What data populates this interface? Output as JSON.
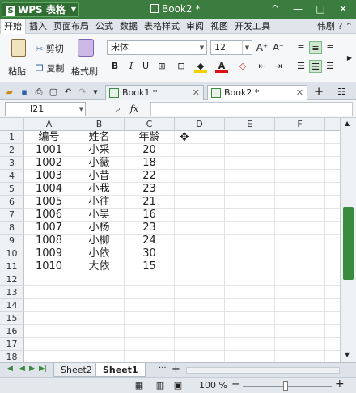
{
  "titlebar": {
    "app_name": "WPS 表格",
    "logo_letter": "S",
    "doc_title": "Book2 *",
    "controls": [
      "^",
      "—",
      "□",
      "✕"
    ]
  },
  "menubar": {
    "items": [
      "开始",
      "插入",
      "页面布局",
      "公式",
      "数据",
      "表格样式",
      "审阅",
      "视图",
      "开发工具"
    ],
    "active_index": 0,
    "right_text": "伟剧"
  },
  "ribbon": {
    "paste": "粘贴",
    "cut": "剪切",
    "copy": "复制",
    "format_painter": "格式刷",
    "font_name": "宋体",
    "font_size": "12",
    "bold": "B",
    "italic": "I",
    "underline": "U",
    "grow_font": "A⁺",
    "shrink_font": "A⁻"
  },
  "tabs": {
    "book1": "Book1 *",
    "book2": "Book2 *",
    "add": "+"
  },
  "formula": {
    "cell_ref": "I21",
    "zoom_icon": "🔍",
    "fx": "fx",
    "content": ""
  },
  "grid": {
    "columns": [
      "A",
      "B",
      "C",
      "D",
      "E",
      "F"
    ],
    "rows": [
      "1",
      "2",
      "3",
      "4",
      "5",
      "6",
      "7",
      "8",
      "9",
      "10",
      "11",
      "12",
      "13",
      "14",
      "15",
      "16",
      "17",
      "18"
    ],
    "data": [
      [
        "编号",
        "姓名",
        "年龄"
      ],
      [
        "1001",
        "小采",
        "20"
      ],
      [
        "1002",
        "小薇",
        "18"
      ],
      [
        "1003",
        "小昔",
        "22"
      ],
      [
        "1004",
        "小我",
        "23"
      ],
      [
        "1005",
        "小往",
        "21"
      ],
      [
        "1006",
        "小吴",
        "16"
      ],
      [
        "1007",
        "小杨",
        "23"
      ],
      [
        "1008",
        "小柳",
        "24"
      ],
      [
        "1009",
        "小依",
        "30"
      ],
      [
        "1010",
        "大依",
        "15"
      ]
    ]
  },
  "sheets": {
    "names": [
      "Sheet2",
      "Sheet1"
    ],
    "active": "Sheet1",
    "add": "+",
    "more": "···"
  },
  "status": {
    "zoom": "100 %",
    "minus": "−",
    "plus": "+"
  },
  "colors": {
    "accent": "#3a7d3f",
    "accent_dark": "#2f6d33"
  }
}
